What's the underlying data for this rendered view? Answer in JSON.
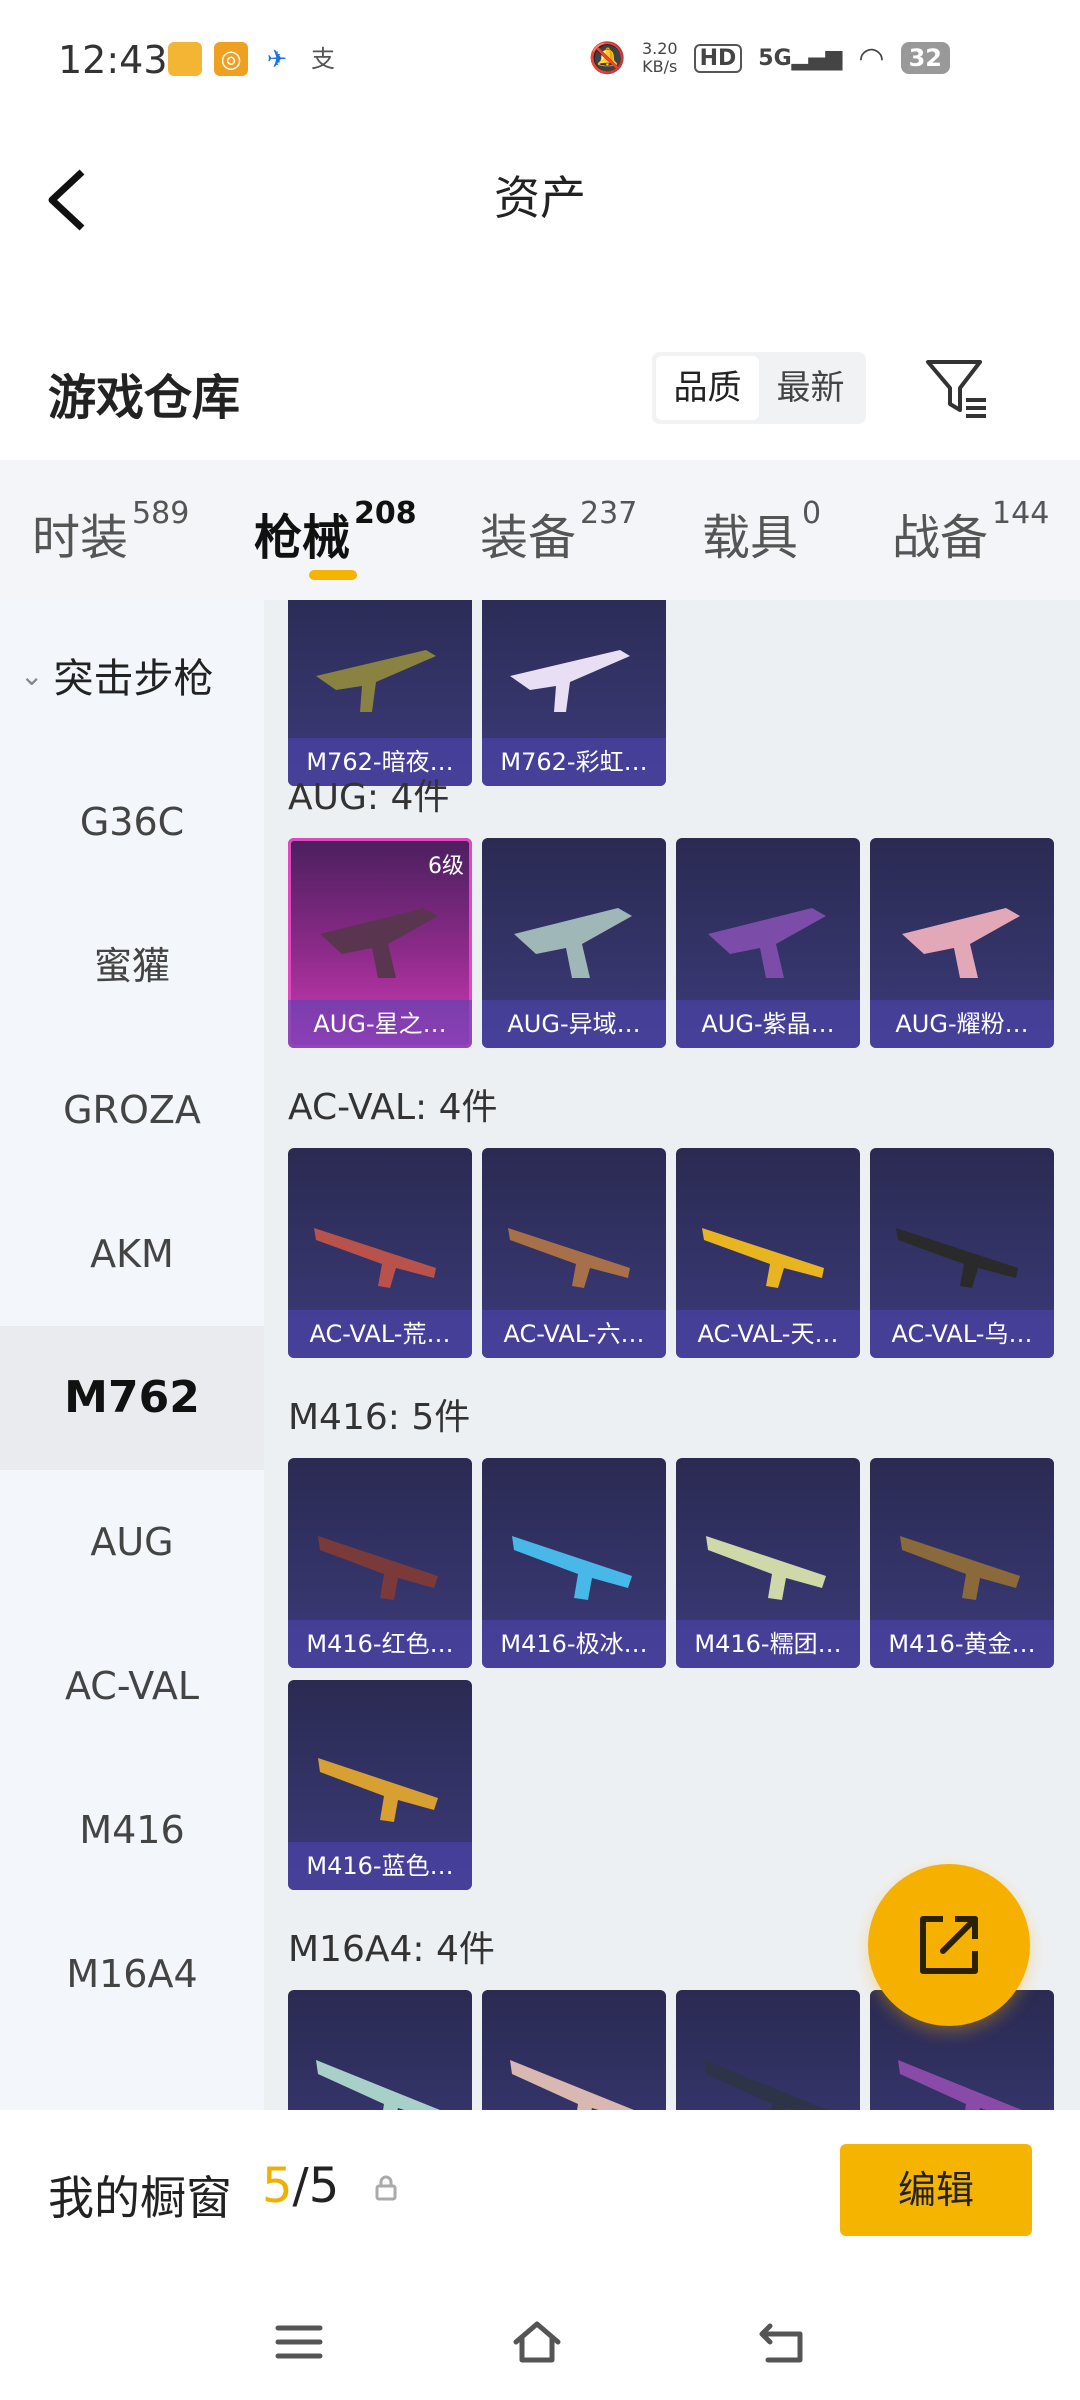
{
  "status": {
    "time": "12:43",
    "net_speed_value": "3.20",
    "net_speed_unit": "KB/s",
    "hd": "HD",
    "signal": "5G",
    "battery": "32"
  },
  "header": {
    "title": "资产"
  },
  "warehouse": {
    "title": "游戏仓库",
    "sort_quality": "品质",
    "sort_latest": "最新"
  },
  "tabs": [
    {
      "label": "时装",
      "count": "589"
    },
    {
      "label": "枪械",
      "count": "208"
    },
    {
      "label": "装备",
      "count": "237"
    },
    {
      "label": "载具",
      "count": "0"
    },
    {
      "label": "战备",
      "count": "144"
    }
  ],
  "sidebar": {
    "group": "突击步枪",
    "items": [
      "G36C",
      "蜜獾",
      "GROZA",
      "AKM",
      "M762",
      "AUG",
      "AC-VAL",
      "M416",
      "M16A4"
    ]
  },
  "sections": {
    "m762": {
      "items": [
        "M762-暗夜…",
        "M762-彩虹…"
      ]
    },
    "aug": {
      "label": "AUG: 4件",
      "items": [
        "AUG-星之…",
        "AUG-异域…",
        "AUG-紫晶…",
        "AUG-耀粉…"
      ],
      "level": "6级"
    },
    "acval": {
      "label": "AC-VAL: 4件",
      "items": [
        "AC-VAL-荒…",
        "AC-VAL-六…",
        "AC-VAL-天…",
        "AC-VAL-乌…"
      ]
    },
    "m416": {
      "label": "M416: 5件",
      "items": [
        "M416-红色…",
        "M416-极冰…",
        "M416-糯团…",
        "M416-黄金…",
        "M416-蓝色…"
      ]
    },
    "m16a4": {
      "label": "M16A4: 4件"
    }
  },
  "showcase": {
    "label": "我的橱窗",
    "current": "5",
    "separator": "/",
    "total": "5",
    "edit": "编辑"
  },
  "colors": {
    "accent": "#f5b400",
    "card": "#3c3b7a",
    "legendary": "#d33ab8"
  }
}
